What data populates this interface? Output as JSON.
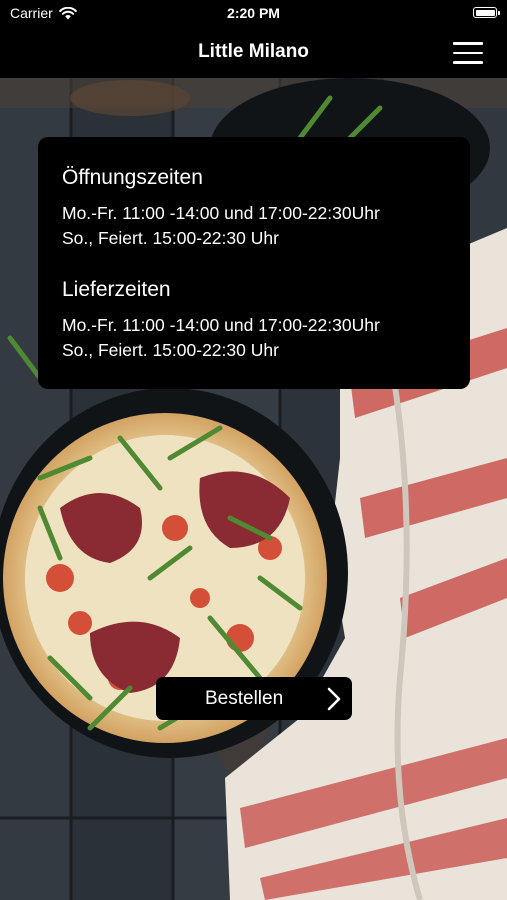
{
  "status_bar": {
    "carrier": "Carrier",
    "time": "2:20 PM"
  },
  "nav": {
    "title": "Little Milano",
    "menu_icon": "hamburger-menu-icon"
  },
  "hero": {
    "image": "pizza-on-wooden-table"
  },
  "info_card": {
    "opening": {
      "heading": "Öffnungszeiten",
      "lines": [
        "Mo.-Fr. 11:00 -14:00 und 17:00-22:30Uhr",
        "So., Feiert. 15:00-22:30 Uhr"
      ]
    },
    "delivery": {
      "heading": "Lieferzeiten",
      "lines": [
        "Mo.-Fr. 11:00 -14:00 und 17:00-22:30Uhr",
        "So., Feiert. 15:00-22:30 Uhr"
      ]
    }
  },
  "order_button": {
    "label": "Bestellen",
    "icon": "chevron-right-icon"
  },
  "colors": {
    "bar_bg": "#000000",
    "text": "#ffffff",
    "card_bg": "#000000"
  }
}
